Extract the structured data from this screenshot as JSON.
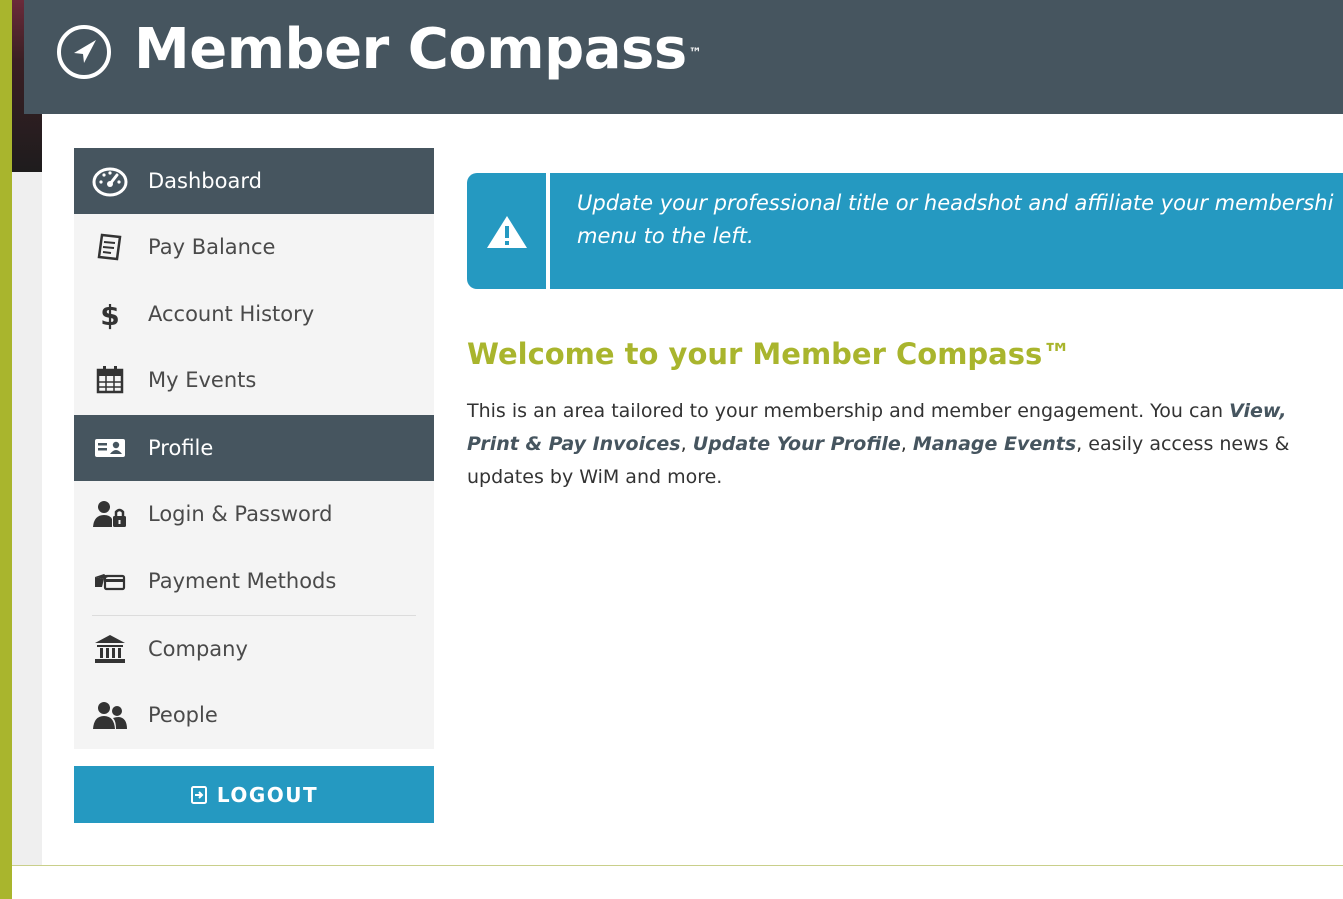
{
  "header": {
    "title": "Member Compass",
    "trademark": "™",
    "logo_icon": "compass-arrow-icon"
  },
  "sidebar": {
    "items": [
      {
        "label": "Dashboard",
        "icon": "speedometer-icon",
        "active": true
      },
      {
        "label": "Pay Balance",
        "icon": "invoice-icon",
        "active": false
      },
      {
        "label": "Account History",
        "icon": "dollar-icon",
        "active": false
      },
      {
        "label": "My Events",
        "icon": "calendar-icon",
        "active": false
      },
      {
        "label": "Profile",
        "icon": "id-card-icon",
        "active": true
      },
      {
        "label": "Login & Password",
        "icon": "user-lock-icon",
        "active": false
      },
      {
        "label": "Payment Methods",
        "icon": "credit-card-hand-icon",
        "active": false
      },
      {
        "label": "Company",
        "icon": "bank-building-icon",
        "active": false
      },
      {
        "label": "People",
        "icon": "users-icon",
        "active": false
      }
    ],
    "logout_label": "LOGOUT",
    "logout_icon": "sign-out-icon"
  },
  "alert": {
    "icon": "warning-triangle-icon",
    "line1": "Update your professional title or headshot and affiliate your membershi",
    "line2": "menu to the left."
  },
  "main": {
    "welcome_title": "Welcome to your Member Compass™",
    "intro_part1": "This is an area tailored to your membership and member engagement. You can ",
    "link_invoices": "View, Print & Pay Invoices",
    "sep1": ", ",
    "link_profile": "Update Your Profile",
    "sep2": ", ",
    "link_events": "Manage Events",
    "intro_part2": ", easily access news & updates by WiM and more."
  },
  "colors": {
    "header_bg": "#46555f",
    "accent_blue": "#2599c1",
    "accent_green": "#a9b52d",
    "sidebar_bg": "#f4f4f4"
  }
}
